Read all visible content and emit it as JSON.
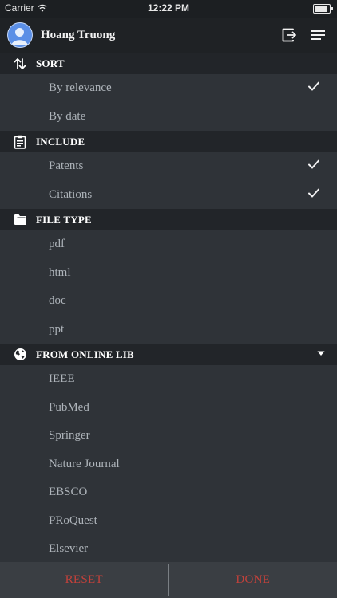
{
  "status_bar": {
    "carrier": "Carrier",
    "time": "12:22 PM",
    "battery_level": 0.95
  },
  "header": {
    "username": "Hoang Truong",
    "icons": [
      "avatar",
      "logout-icon",
      "menu-icon"
    ]
  },
  "sections": {
    "sort": {
      "title": "SORT",
      "icon": "sort-arrows-icon",
      "items": [
        {
          "label": "By relevance",
          "checked": true
        },
        {
          "label": "By date",
          "checked": false
        }
      ]
    },
    "include": {
      "title": "INCLUDE",
      "icon": "clipboard-icon",
      "items": [
        {
          "label": "Patents",
          "checked": true
        },
        {
          "label": "Citations",
          "checked": true
        }
      ]
    },
    "file_type": {
      "title": "FILE TYPE",
      "icon": "folder-icon",
      "items": [
        {
          "label": "pdf"
        },
        {
          "label": "html"
        },
        {
          "label": "doc"
        },
        {
          "label": "ppt"
        }
      ]
    },
    "online_lib": {
      "title": "FROM ONLINE LIB",
      "icon": "globe-icon",
      "expanded": true,
      "items": [
        {
          "label": "IEEE"
        },
        {
          "label": "PubMed"
        },
        {
          "label": "Springer"
        },
        {
          "label": "Nature Journal"
        },
        {
          "label": "EBSCO"
        },
        {
          "label": "PRoQuest"
        },
        {
          "label": "Elsevier"
        }
      ]
    }
  },
  "footer": {
    "reset_label": "RESET",
    "done_label": "DONE"
  },
  "colors": {
    "accent_red": "#c2413b",
    "header_bg": "#1f2225",
    "section_bg": "#222529",
    "item_bg": "#2f3338"
  }
}
